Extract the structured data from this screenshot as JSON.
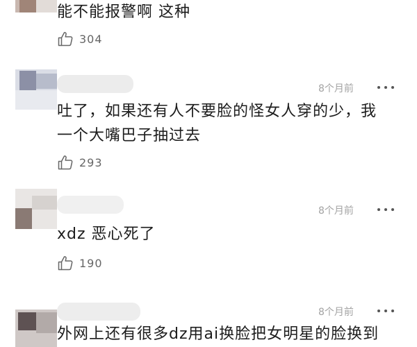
{
  "colors": {
    "text": "#1c1c1c",
    "meta": "#a3a3a3",
    "like_count": "#666666"
  },
  "comments": [
    {
      "time": "",
      "text_lines": [
        "能不能报警啊 这种"
      ],
      "likes": "304",
      "like_icon": "thumbs-up-icon",
      "more_icon": "more-dots-icon"
    },
    {
      "time": "8个月前",
      "text_lines": [
        "吐了，如果还有人不要脸的怪女人穿的少，我",
        "一个大嘴巴子抽过去"
      ],
      "likes": "293",
      "like_icon": "thumbs-up-icon",
      "more_icon": "more-dots-icon"
    },
    {
      "time": "8个月前",
      "text_lines": [
        "xdz 恶心死了"
      ],
      "likes": "190",
      "like_icon": "thumbs-up-icon",
      "more_icon": "more-dots-icon"
    },
    {
      "time": "8个月前",
      "text_lines": [
        "外网上还有很多dz用ai换脸把女明星的脸换到"
      ],
      "likes": "",
      "like_icon": "thumbs-up-icon",
      "more_icon": "more-dots-icon"
    }
  ]
}
